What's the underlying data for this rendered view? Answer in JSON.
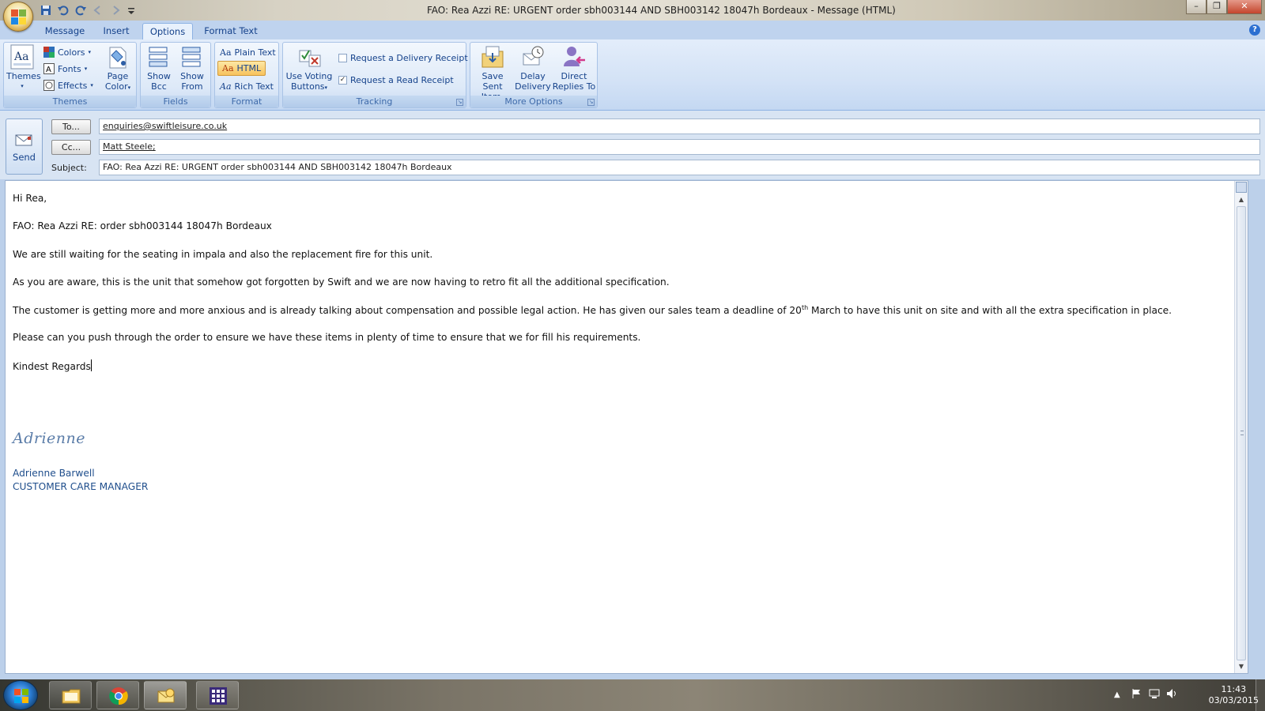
{
  "window": {
    "title": "FAO: Rea Azzi RE: URGENT  order sbh003144 AND SBH003142  18047h Bordeaux - Message (HTML)",
    "minimize": "–",
    "maximize": "❐",
    "close": "✕"
  },
  "tabs": [
    {
      "label": "Message",
      "active": false
    },
    {
      "label": "Insert",
      "active": false
    },
    {
      "label": "Options",
      "active": true
    },
    {
      "label": "Format Text",
      "active": false
    }
  ],
  "ribbon": {
    "themes": {
      "group_label": "Themes",
      "themes_button": "Themes",
      "colors": "Colors",
      "fonts": "Fonts",
      "effects": "Effects",
      "page_color_line1": "Page",
      "page_color_line2": "Color"
    },
    "fields": {
      "group_label": "Fields",
      "show_bcc_line1": "Show",
      "show_bcc_line2": "Bcc",
      "show_from_line1": "Show",
      "show_from_line2": "From"
    },
    "format": {
      "group_label": "Format",
      "plain_text": "Plain Text",
      "html": "HTML",
      "rich_text": "Rich Text",
      "selected": "HTML"
    },
    "tracking": {
      "group_label": "Tracking",
      "voting_line1": "Use Voting",
      "voting_line2": "Buttons",
      "delivery_receipt": "Request a Delivery Receipt",
      "delivery_receipt_checked": false,
      "read_receipt": "Request a Read Receipt",
      "read_receipt_checked": true
    },
    "more_options": {
      "group_label": "More Options",
      "save_sent_line1": "Save Sent",
      "save_sent_line2": "Item",
      "delay_line1": "Delay",
      "delay_line2": "Delivery",
      "direct_line1": "Direct",
      "direct_line2": "Replies To"
    }
  },
  "header": {
    "send": "Send",
    "to_button": "To...",
    "cc_button": "Cc...",
    "subject_label": "Subject:",
    "to_value": "enquiries@swiftleisure.co.uk",
    "cc_value": "Matt Steele;",
    "subject_value": "FAO: Rea Azzi RE: URGENT  order sbh003144 AND SBH003142  18047h Bordeaux"
  },
  "body": {
    "greeting": "Hi Rea,",
    "line1": "FAO: Rea Azzi RE: order sbh003144 18047h Bordeaux",
    "line2": "We are still waiting for the seating in impala and also the replacement fire for this unit.",
    "line3": "As you are aware, this is the unit that somehow got forgotten by Swift and we are now having to retro fit all the additional specification.",
    "line4_a": "The customer is getting more and more anxious and is already talking about compensation and possible legal action.   He has given our sales team a deadline of 20",
    "line4_sup": "th",
    "line4_b": " March to have this unit on site and with all the extra specification in place.",
    "line5": "Please can you push through the order to ensure we have these items in plenty of time to ensure that we for fill his requirements.",
    "closing": "Kindest Regards",
    "signature_script": "Adrienne",
    "signature_name": "Adrienne Barwell",
    "signature_title": "CUSTOMER CARE MANAGER"
  },
  "taskbar": {
    "apps": [
      "windows-explorer",
      "chrome",
      "outlook",
      "other-app"
    ],
    "time": "11:43",
    "date": "03/03/2015"
  }
}
